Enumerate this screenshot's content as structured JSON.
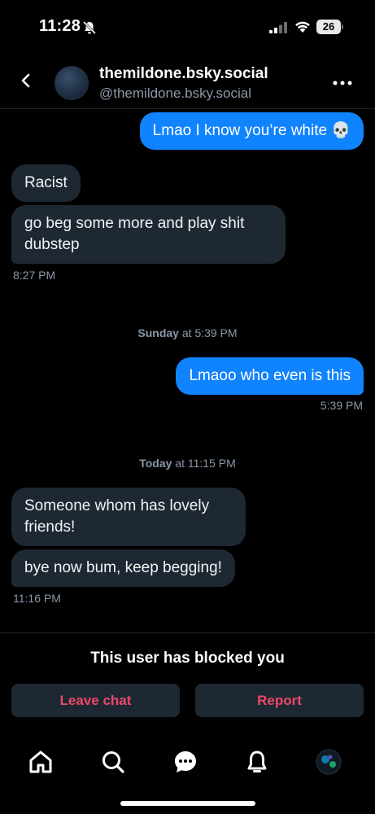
{
  "status_bar": {
    "time": "11:28",
    "battery": "26",
    "icons": [
      "bell-slash-icon",
      "cellular-signal-icon",
      "wifi-icon",
      "battery-icon"
    ]
  },
  "header": {
    "display_name": "themildone.bsky.social",
    "handle": "@themildone.bsky.social",
    "icons": [
      "chevron-left-icon",
      "more-horizontal-icon"
    ]
  },
  "messages": [
    {
      "text": "Lmao I know you’re white 💀",
      "direction": "outgoing"
    },
    {
      "text": "Racist",
      "direction": "incoming"
    },
    {
      "text": "go beg some more and play shit dubstep",
      "direction": "incoming"
    },
    {
      "text": "Lmaoo who even is this",
      "direction": "outgoing"
    },
    {
      "text": "Someone whom has lovely friends!",
      "direction": "incoming"
    },
    {
      "text": "bye now bum, keep begging!",
      "direction": "incoming"
    }
  ],
  "timestamps": {
    "t1": "8:27 PM",
    "t2": "5:39 PM",
    "t3": "11:16 PM"
  },
  "day_separators": [
    {
      "day": "Sunday",
      "rest": "at 5:39 PM"
    },
    {
      "day": "Today",
      "rest": "at 11:15 PM"
    }
  ],
  "footer": {
    "blocked_text": "This user has blocked you",
    "leave_label": "Leave chat",
    "report_label": "Report"
  },
  "tab_bar": {
    "tabs": [
      "home-icon",
      "search-icon",
      "chat-icon",
      "bell-icon",
      "profile-avatar"
    ],
    "active": "chat-icon"
  },
  "colors": {
    "background": "#000000",
    "outgoing_bubble": "#1083fe",
    "incoming_bubble": "#1e2833",
    "muted_text": "#8b98a8",
    "danger": "#ec4868"
  }
}
